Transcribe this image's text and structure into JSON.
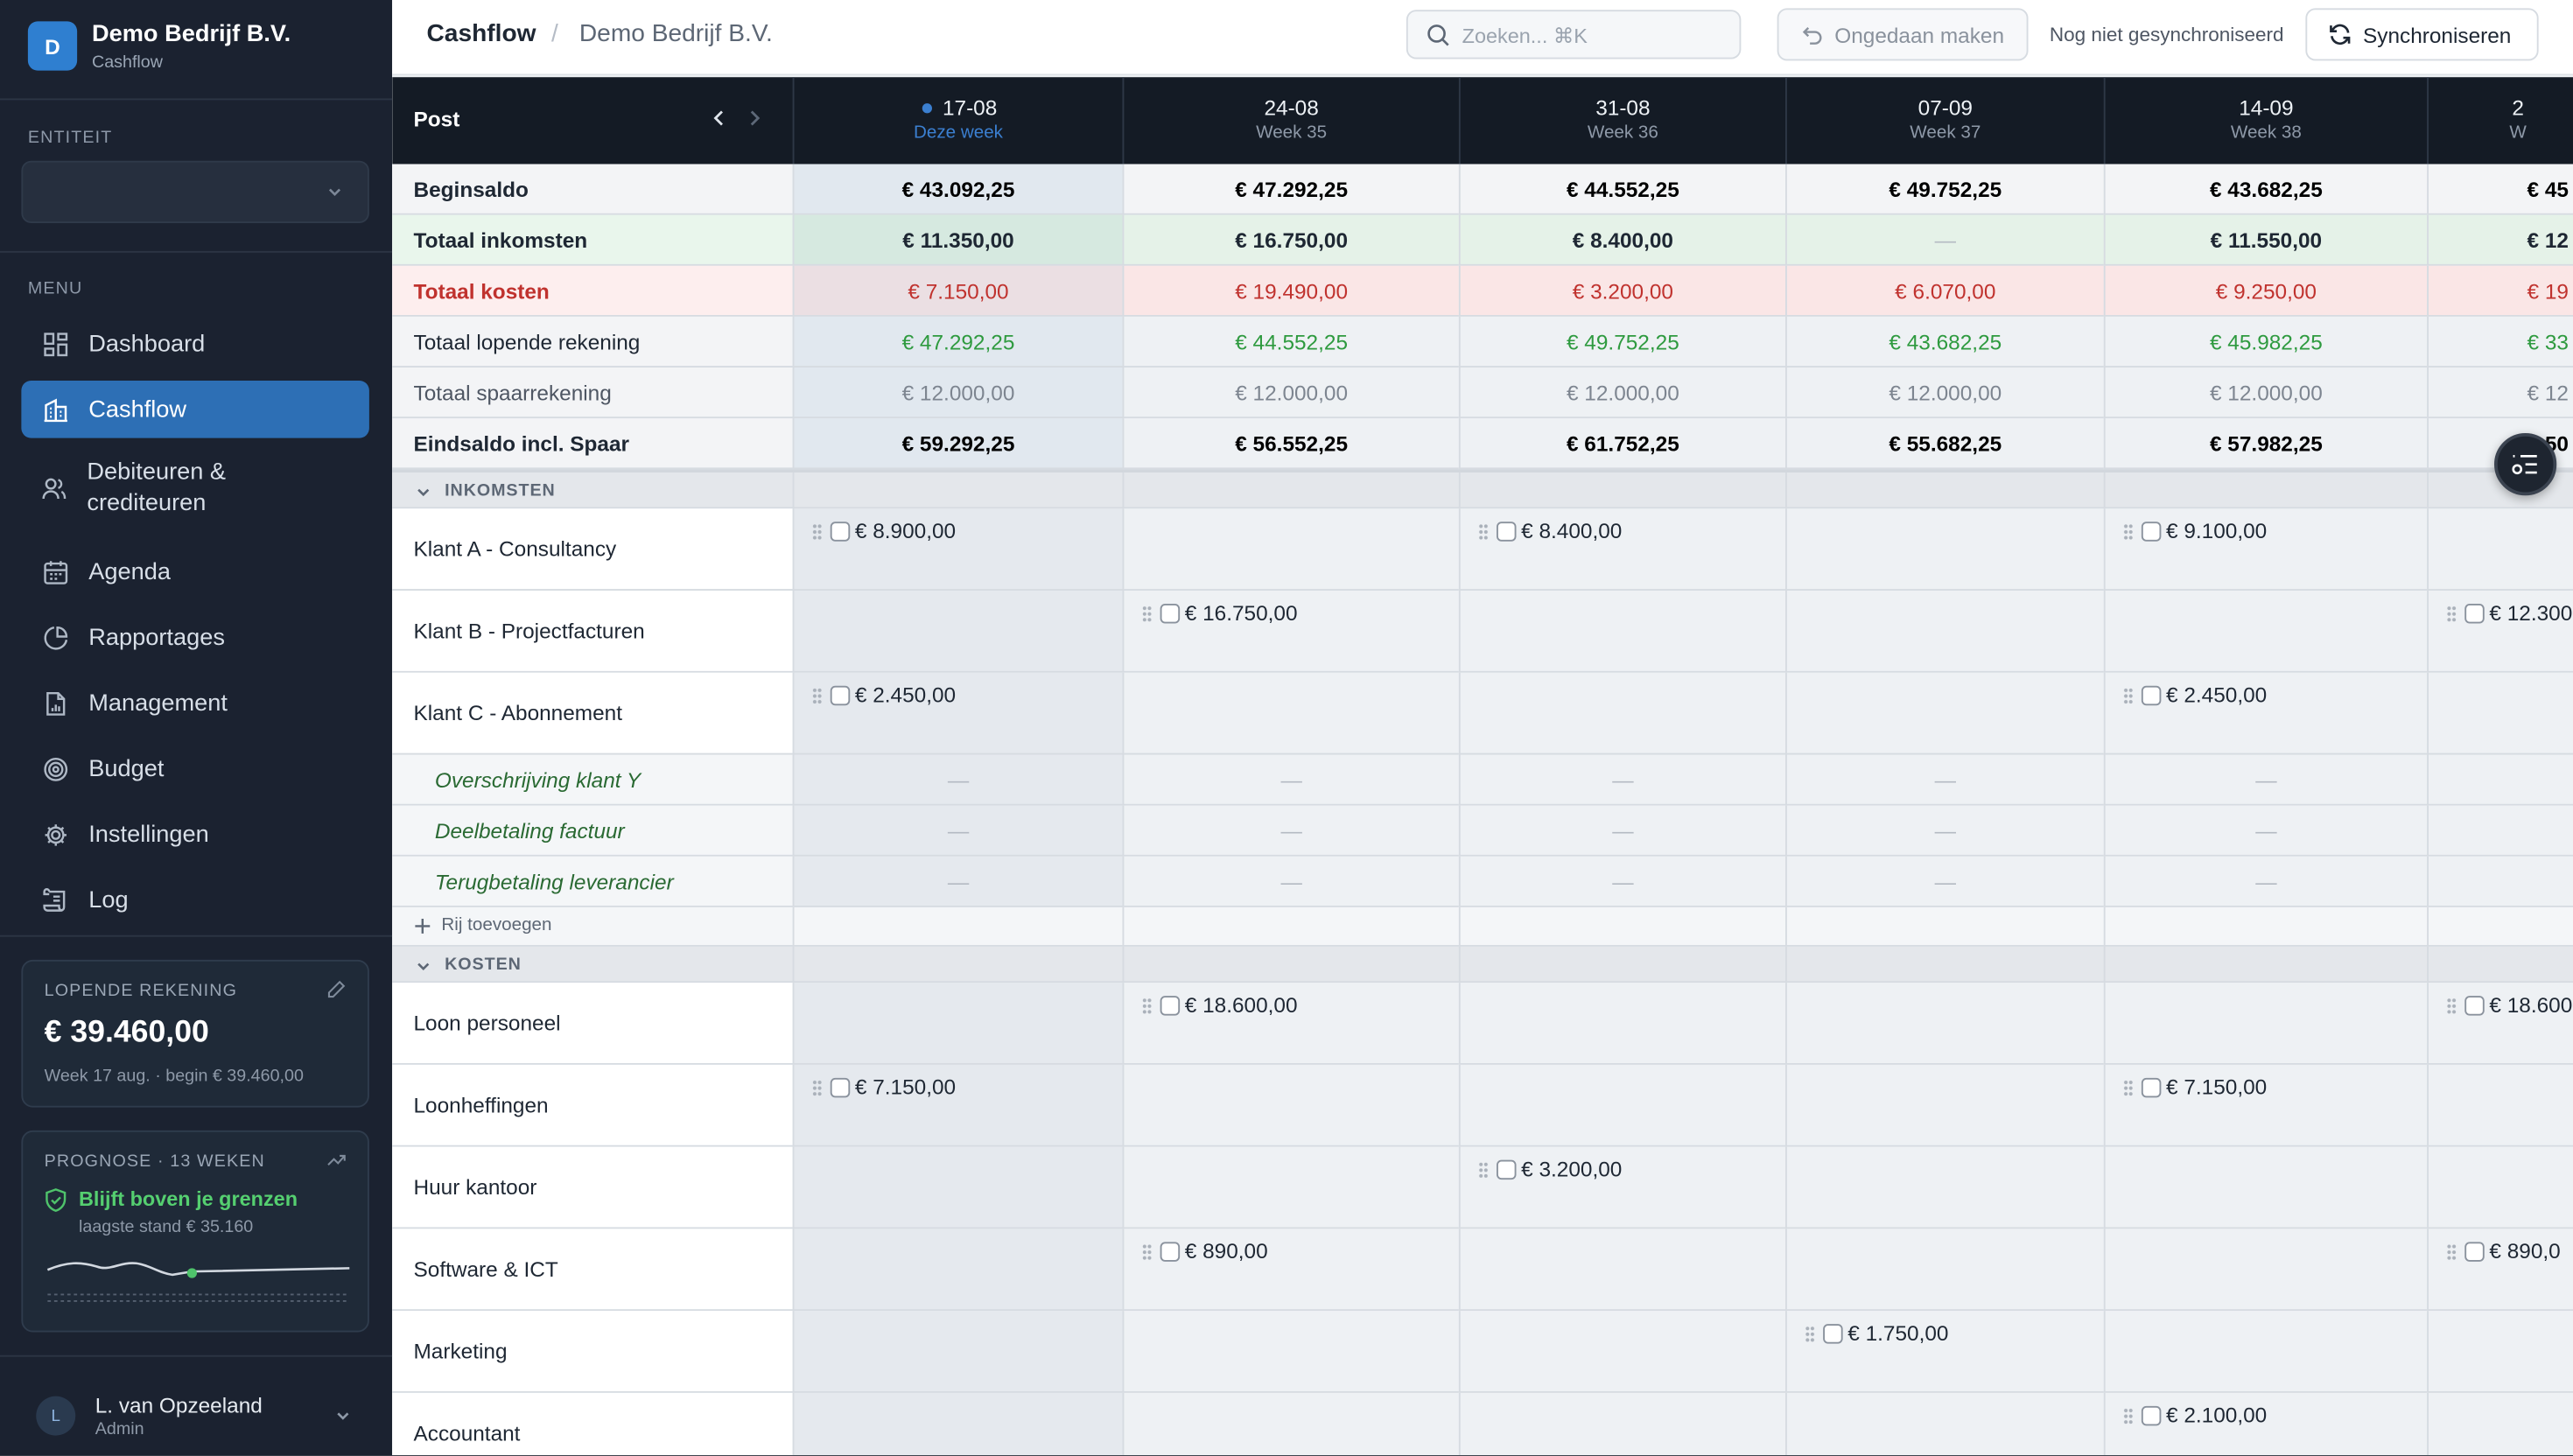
{
  "brand": {
    "initial": "D",
    "name": "Demo Bedrijf B.V.",
    "sub": "Cashflow"
  },
  "entity": {
    "label": "ENTITEIT",
    "value": ""
  },
  "menu": {
    "label": "MENU",
    "items": [
      {
        "label": "Dashboard",
        "icon": "dashboard-icon"
      },
      {
        "label": "Cashflow",
        "icon": "building-icon"
      },
      {
        "label": "Debiteuren & crediteuren",
        "icon": "users-icon"
      },
      {
        "label": "Agenda",
        "icon": "calendar-icon"
      },
      {
        "label": "Rapportages",
        "icon": "pie-chart-icon"
      },
      {
        "label": "Management",
        "icon": "document-chart-icon"
      },
      {
        "label": "Budget",
        "icon": "target-icon"
      },
      {
        "label": "Instellingen",
        "icon": "gear-icon"
      },
      {
        "label": "Log",
        "icon": "scroll-icon"
      }
    ]
  },
  "account": {
    "title": "LOPENDE REKENING",
    "amount": "€ 39.460,00",
    "sub": "Week 17 aug. · begin € 39.460,00"
  },
  "forecast": {
    "title": "PROGNOSE · 13 WEKEN",
    "status": "Blijft boven je grenzen",
    "sub": "laagste stand € 35.160"
  },
  "user": {
    "initial": "L",
    "name": "L. van Opzeeland",
    "role": "Admin"
  },
  "topbar": {
    "crumb": "Cashflow",
    "company": "Demo Bedrijf B.V.",
    "search_placeholder": "Zoeken... ⌘K",
    "undo": "Ongedaan maken",
    "sync_status": "Nog niet gesynchroniseerd",
    "sync": "Synchroniseren"
  },
  "grid": {
    "post_label": "Post",
    "columns": [
      {
        "date": "17-08",
        "week": "Deze week",
        "current": true
      },
      {
        "date": "24-08",
        "week": "Week 35"
      },
      {
        "date": "31-08",
        "week": "Week 36"
      },
      {
        "date": "07-09",
        "week": "Week 37"
      },
      {
        "date": "14-09",
        "week": "Week 38"
      },
      {
        "date": "2",
        "week": "W"
      }
    ],
    "summary": [
      {
        "label": "Beginsaldo",
        "values": [
          "€ 43.092,25",
          "€ 47.292,25",
          "€ 44.552,25",
          "€ 49.752,25",
          "€ 43.682,25",
          "€ 45"
        ]
      },
      {
        "label": "Totaal inkomsten",
        "values": [
          "€ 11.350,00",
          "€ 16.750,00",
          "€ 8.400,00",
          "—",
          "€ 11.550,00",
          "€ 12"
        ]
      },
      {
        "label": "Totaal kosten",
        "values": [
          "€ 7.150,00",
          "€ 19.490,00",
          "€ 3.200,00",
          "€ 6.070,00",
          "€ 9.250,00",
          "€ 19"
        ]
      },
      {
        "label": "Totaal lopende rekening",
        "values": [
          "€ 47.292,25",
          "€ 44.552,25",
          "€ 49.752,25",
          "€ 43.682,25",
          "€ 45.982,25",
          "€ 33"
        ]
      },
      {
        "label": "Totaal spaarrekening",
        "values": [
          "€ 12.000,00",
          "€ 12.000,00",
          "€ 12.000,00",
          "€ 12.000,00",
          "€ 12.000,00",
          "€ 12"
        ]
      },
      {
        "label": "Eindsaldo incl. Spaar",
        "values": [
          "€ 59.292,25",
          "€ 56.552,25",
          "€ 61.752,25",
          "€ 55.682,25",
          "€ 57.982,25",
          "€ 50"
        ]
      }
    ],
    "income_header": "INKOMSTEN",
    "income_rows": [
      {
        "label": "Klant A - Consultancy",
        "values": [
          "€ 8.900,00",
          "",
          "€ 8.400,00",
          "",
          "€ 9.100,00",
          ""
        ]
      },
      {
        "label": "Klant B - Projectfacturen",
        "values": [
          "",
          "€ 16.750,00",
          "",
          "",
          "",
          "€ 12.300"
        ]
      },
      {
        "label": "Klant C - Abonnement",
        "values": [
          "€ 2.450,00",
          "",
          "",
          "",
          "€ 2.450,00",
          ""
        ]
      }
    ],
    "unmatched": [
      {
        "label": "Overschrijving klant Y"
      },
      {
        "label": "Deelbetaling factuur"
      },
      {
        "label": "Terugbetaling leverancier"
      }
    ],
    "empty_dash": "—",
    "add_row": "Rij toevoegen",
    "cost_header": "KOSTEN",
    "cost_rows": [
      {
        "label": "Loon personeel",
        "values": [
          "",
          "€ 18.600,00",
          "",
          "",
          "",
          "€ 18.600"
        ]
      },
      {
        "label": "Loonheffingen",
        "values": [
          "€ 7.150,00",
          "",
          "",
          "",
          "€ 7.150,00",
          ""
        ]
      },
      {
        "label": "Huur kantoor",
        "values": [
          "",
          "",
          "€ 3.200,00",
          "",
          "",
          ""
        ]
      },
      {
        "label": "Software & ICT",
        "values": [
          "",
          "€ 890,00",
          "",
          "",
          "",
          "€ 890,0"
        ]
      },
      {
        "label": "Marketing",
        "values": [
          "",
          "",
          "",
          "€ 1.750,00",
          "",
          ""
        ]
      },
      {
        "label": "Accountant",
        "values": [
          "",
          "",
          "",
          "",
          "€ 2.100,00",
          ""
        ]
      }
    ]
  }
}
